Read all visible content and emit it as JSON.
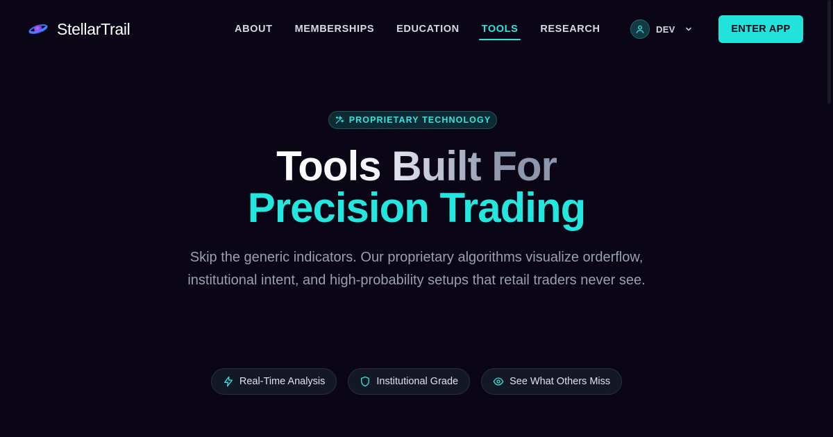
{
  "brand": {
    "name": "StellarTrail",
    "accent": "#22e3dc"
  },
  "nav": {
    "items": [
      {
        "label": "ABOUT",
        "active": false
      },
      {
        "label": "MEMBERSHIPS",
        "active": false
      },
      {
        "label": "EDUCATION",
        "active": false
      },
      {
        "label": "TOOLS",
        "active": true
      },
      {
        "label": "RESEARCH",
        "active": false
      }
    ]
  },
  "user": {
    "name": "DEV",
    "icon": "user-icon"
  },
  "cta": {
    "label": "ENTER APP"
  },
  "hero": {
    "badge": {
      "label": "PROPRIETARY TECHNOLOGY",
      "icon": "sparkles-icon"
    },
    "headline_line1": "Tools Built For",
    "headline_line2": "Precision Trading",
    "subtitle": "Skip the generic indicators. Our proprietary algorithms visualize orderflow, institutional intent, and high-probability setups that retail traders never see."
  },
  "features": [
    {
      "label": "Real-Time Analysis",
      "icon": "lightning-icon"
    },
    {
      "label": "Institutional Grade",
      "icon": "shield-icon"
    },
    {
      "label": "See What Others Miss",
      "icon": "eye-icon"
    }
  ]
}
